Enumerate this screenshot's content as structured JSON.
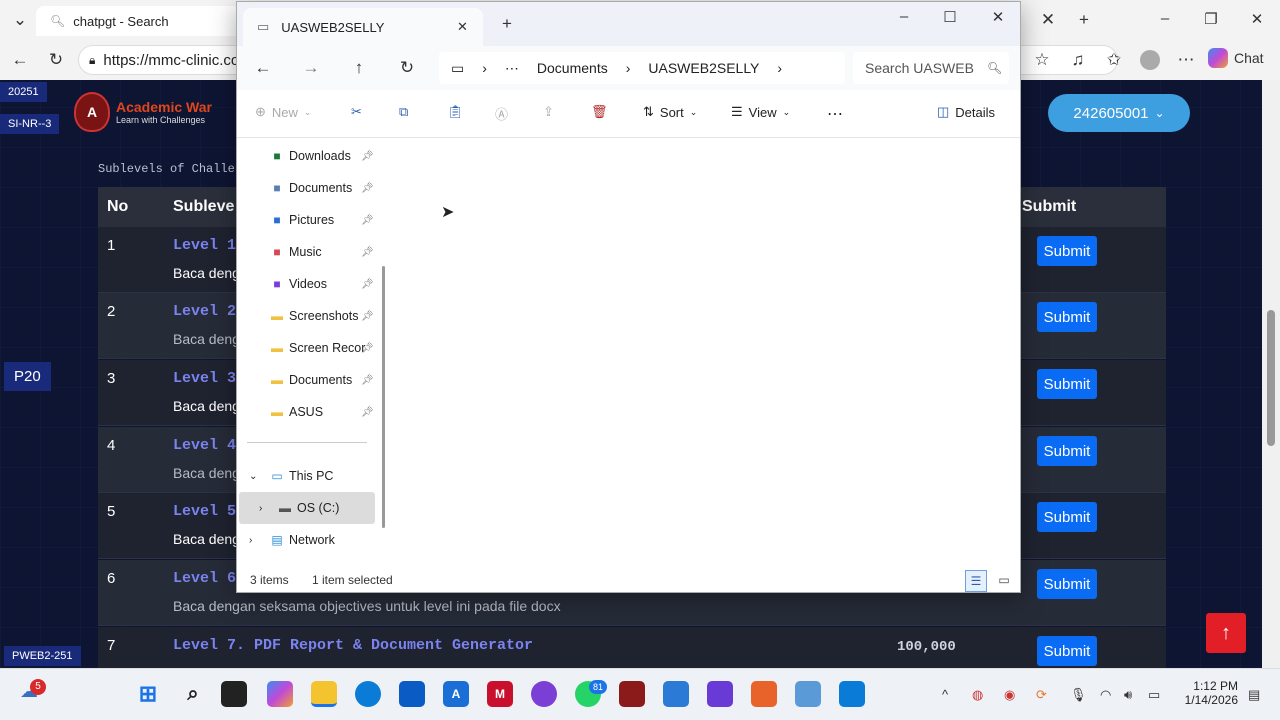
{
  "browser": {
    "tab_title": "chatpgt - Search",
    "url": "https://mmc-clinic.co",
    "chat_label": "Chat"
  },
  "page": {
    "tag_year": "20251",
    "tag_group": "SI-NR--3",
    "side_tag": "P20",
    "course_tag": "PWEB2-251",
    "logo_line1": "Academic War",
    "logo_line2": "Learn with Challenges",
    "user_id": "242605001",
    "caption": "Sublevels of Challeng",
    "headers": {
      "no": "No",
      "sublevel": "Subleve",
      "submit": "Submit"
    },
    "rows": [
      {
        "no": "1",
        "level": "Level 1",
        "desc": "Baca deng",
        "price": "",
        "submit": "Submit"
      },
      {
        "no": "2",
        "level": "Level 2",
        "desc": "Baca deng",
        "price": "",
        "submit": "Submit"
      },
      {
        "no": "3",
        "level": "Level 3",
        "desc": "Baca deng",
        "price": "",
        "submit": "Submit"
      },
      {
        "no": "4",
        "level": "Level 4",
        "desc": "Baca deng",
        "price": "",
        "submit": "Submit"
      },
      {
        "no": "5",
        "level": "Level 5",
        "desc": "Baca deng",
        "price": "",
        "submit": "Submit"
      },
      {
        "no": "6",
        "level": "Level 6",
        "desc": "Baca dengan seksama objectives untuk level ini pada file docx",
        "price": "",
        "submit": "Submit"
      },
      {
        "no": "7",
        "level": "Level 7. PDF Report & Document Generator",
        "desc": "",
        "price": "100,000",
        "submit": "Submit"
      }
    ]
  },
  "explorer": {
    "tab_title": "UASWEB2SELLY",
    "breadcrumb": [
      "Documents",
      "UASWEB2SELLY"
    ],
    "search_placeholder": "Search UASWEB",
    "cmd": {
      "new": "New",
      "sort": "Sort",
      "view": "View",
      "details": "Details"
    },
    "nav_items": [
      {
        "label": "Downloads",
        "icon": "download-icon",
        "color": "#1b7a3a"
      },
      {
        "label": "Documents",
        "icon": "document-icon",
        "color": "#5a7fb0"
      },
      {
        "label": "Pictures",
        "icon": "picture-icon",
        "color": "#2a6fd0"
      },
      {
        "label": "Music",
        "icon": "music-icon",
        "color": "#d04a5a"
      },
      {
        "label": "Videos",
        "icon": "video-icon",
        "color": "#7b3fd6"
      },
      {
        "label": "Screenshots",
        "icon": "folder-icon",
        "color": "#f0c040"
      },
      {
        "label": "Screen Recor",
        "icon": "folder-icon",
        "color": "#f0c040"
      },
      {
        "label": "Documents",
        "icon": "folder-icon",
        "color": "#f0c040"
      },
      {
        "label": "ASUS",
        "icon": "folder-icon",
        "color": "#f0c040"
      }
    ],
    "tree": [
      {
        "label": "This PC",
        "icon": "computer-icon"
      },
      {
        "label": "OS (C:)",
        "icon": "drive-icon"
      },
      {
        "label": "Network",
        "icon": "network-icon"
      }
    ],
    "status_items": "3 items",
    "status_selected": "1 item selected"
  },
  "taskbar": {
    "widgets_badge": "5",
    "whatsapp_badge": "81",
    "time": "1:12 PM",
    "date": "1/14/2026"
  }
}
